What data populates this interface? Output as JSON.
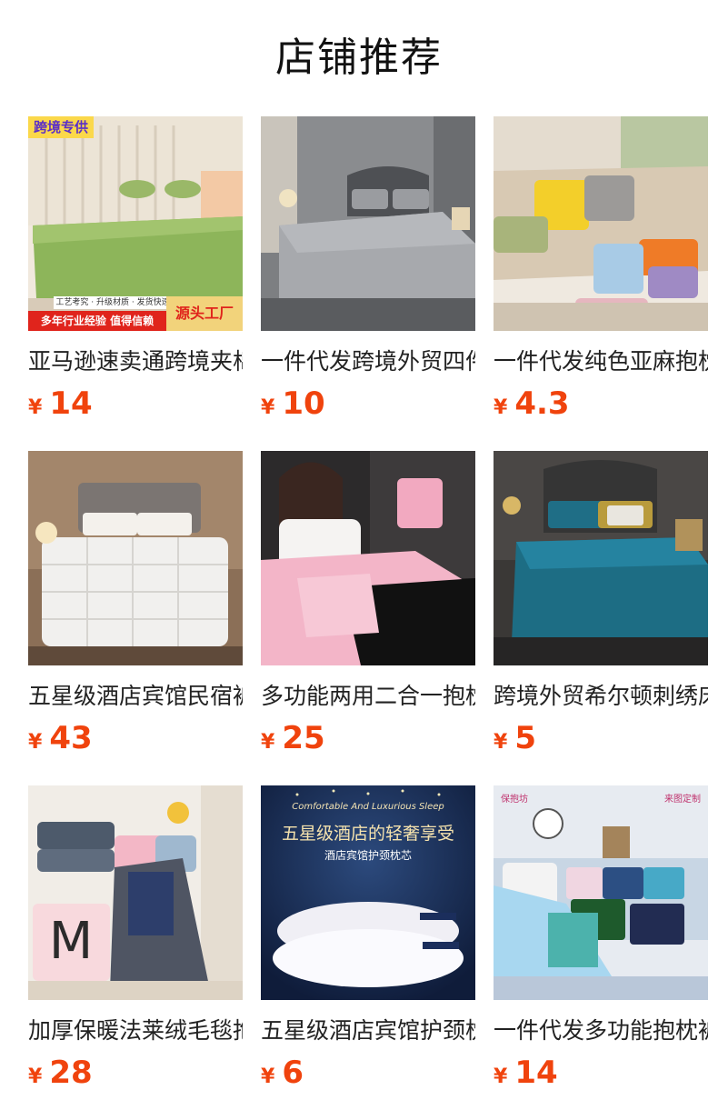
{
  "header": {
    "title": "店铺推荐"
  },
  "colors": {
    "price": "#f0430d",
    "text": "#222222"
  },
  "products": [
    {
      "name": "亚马逊速卖通跨境夹棉床笠",
      "currency": "¥",
      "price": "14",
      "badges": {
        "top": "跨境专供",
        "bottom": "多年行业经验 值得信赖",
        "strip": "工艺考究 · 升级材质 · 发货快速",
        "right": "源头工厂"
      }
    },
    {
      "name": "一件代发跨境外贸四件套",
      "currency": "¥",
      "price": "10"
    },
    {
      "name": "一件代发纯色亚麻抱枕套",
      "currency": "¥",
      "price": "4.3"
    },
    {
      "name": "五星级酒店宾馆民宿被子",
      "currency": "¥",
      "price": "43"
    },
    {
      "name": "多功能两用二合一抱枕被",
      "currency": "¥",
      "price": "25"
    },
    {
      "name": "跨境外贸希尔顿刺绣床笠",
      "currency": "¥",
      "price": "5"
    },
    {
      "name": "加厚保暖法莱绒毛毯抱枕",
      "currency": "¥",
      "price": "28"
    },
    {
      "name": "五星级酒店宾馆护颈枕芯",
      "currency": "¥",
      "price": "6",
      "overlay": {
        "headline": "五星级酒店的轻奢享受",
        "sub": "酒店宾馆护颈枕芯",
        "script": "Comfortable And Luxurious Sleep"
      }
    },
    {
      "name": "一件代发多功能抱枕被子",
      "currency": "¥",
      "price": "14",
      "overlay": {
        "left": "保抱坊",
        "right": "来图定制"
      }
    }
  ]
}
